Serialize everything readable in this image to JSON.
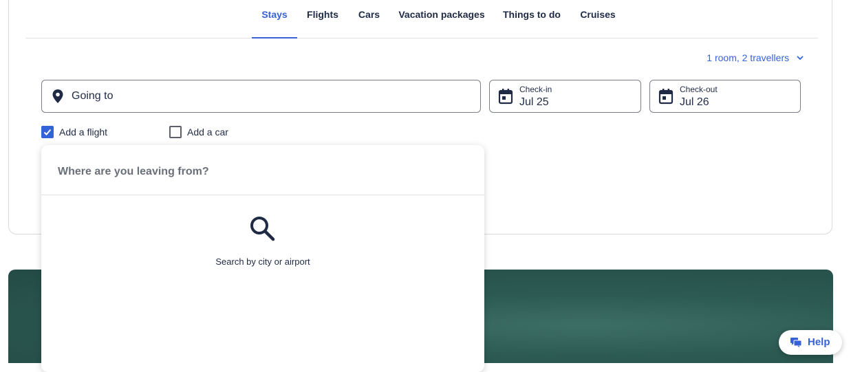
{
  "tabs": [
    {
      "label": "Stays",
      "active": true
    },
    {
      "label": "Flights",
      "active": false
    },
    {
      "label": "Cars",
      "active": false
    },
    {
      "label": "Vacation packages",
      "active": false
    },
    {
      "label": "Things to do",
      "active": false
    },
    {
      "label": "Cruises",
      "active": false
    }
  ],
  "travellers": {
    "label": "1 room, 2 travellers",
    "icon": "chevron-down-icon"
  },
  "going_to": {
    "label": "Going to",
    "icon": "map-pin-icon"
  },
  "check_in": {
    "label": "Check-in",
    "value": "Jul 25",
    "icon": "calendar-icon"
  },
  "check_out": {
    "label": "Check-out",
    "value": "Jul 26",
    "icon": "calendar-icon"
  },
  "add_flight": {
    "label": "Add a flight",
    "checked": true
  },
  "add_car": {
    "label": "Add a car",
    "checked": false
  },
  "dropdown": {
    "placeholder": "Where are you leaving from?",
    "hint": "Search by city or airport",
    "icon": "search-icon"
  },
  "help": {
    "label": "Help",
    "icon": "chat-icon"
  },
  "colors": {
    "accent": "#3662d8",
    "text": "#1f2a44",
    "border": "#dfe1e5"
  }
}
